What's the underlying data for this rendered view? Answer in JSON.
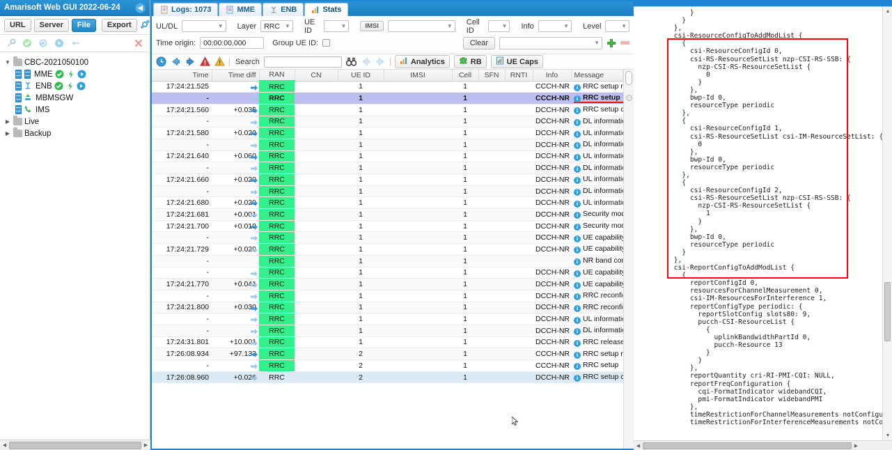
{
  "sidebar": {
    "title": "Amarisoft Web GUI 2022-06-24",
    "collapse_icon": "chevron-left-icon",
    "buttons": {
      "url": "URL",
      "server": "Server",
      "file": "File",
      "export": "Export",
      "settings_icon": "settings-icon"
    },
    "action_icons": [
      "wrench-icon",
      "check-circle-icon",
      "refresh-icon",
      "play-circle-icon",
      "plug-icon",
      "close-icon"
    ],
    "tree": [
      {
        "label": "CBC-2021050100",
        "type": "folder",
        "expanded": true,
        "depth": 0
      },
      {
        "label": "MME",
        "type": "service",
        "depth": 1,
        "badges": [
          "ok",
          "bolt",
          "play"
        ]
      },
      {
        "label": "ENB",
        "type": "service",
        "depth": 1,
        "badges": [
          "ok",
          "bolt",
          "play"
        ]
      },
      {
        "label": "MBMSGW",
        "type": "service",
        "depth": 1,
        "badges": []
      },
      {
        "label": "IMS",
        "type": "service",
        "depth": 1,
        "badges": []
      },
      {
        "label": "Live",
        "type": "folder",
        "expanded": false,
        "depth": 0
      },
      {
        "label": "Backup",
        "type": "folder",
        "expanded": false,
        "depth": 0
      }
    ]
  },
  "tabs": [
    {
      "label": "Logs: 1073",
      "icon": "document-icon",
      "active": false
    },
    {
      "label": "MME",
      "icon": "list-icon",
      "active": false
    },
    {
      "label": "ENB",
      "icon": "tower-icon",
      "active": false
    },
    {
      "label": "Stats",
      "icon": "chart-icon",
      "active": true
    }
  ],
  "filters": {
    "uldl": {
      "label": "UL/DL",
      "value": ""
    },
    "layer": {
      "label": "Layer",
      "value": "RRC"
    },
    "ueid": {
      "label": "UE ID",
      "value": ""
    },
    "imsi": {
      "label": "IMSI",
      "value": ""
    },
    "cellid": {
      "label": "Cell ID",
      "value": ""
    },
    "info": {
      "label": "Info",
      "value": ""
    },
    "level": {
      "label": "Level",
      "value": ""
    },
    "time_origin": {
      "label": "Time origin:",
      "value": "00:00:00.000"
    },
    "group_ue_id": {
      "label": "Group UE ID:",
      "checked": false
    },
    "clear": "Clear",
    "preset": "",
    "add_icon": "plus-icon",
    "remove_icon": "minus-icon"
  },
  "toolbar": {
    "icons": [
      "clock-icon",
      "arrow-left-icon",
      "arrow-right-icon",
      "error-icon",
      "warning-icon"
    ],
    "search_label": "Search",
    "search_value": "",
    "search_placeholder": "",
    "binoculars_icon": "binoculars-icon",
    "prev_icon": "arrow-left-icon",
    "next_icon": "arrow-right-icon",
    "analytics": "Analytics",
    "rb": "RB",
    "ue_caps": "UE Caps"
  },
  "table": {
    "columns": [
      "Time",
      "Time diff",
      "RAN",
      "CN",
      "UE ID",
      "IMSI",
      "Cell",
      "SFN",
      "RNTI",
      "Info",
      "Message"
    ],
    "rows": [
      {
        "time": "17:24:21.525",
        "diff": "",
        "dir": "dl",
        "ran": "RRC",
        "cn": "",
        "ueid": "1",
        "imsi": "",
        "cell": "1",
        "sfn": "",
        "rnti": "",
        "info": "CCCH-NR",
        "msg": "RRC setup request",
        "state": "even"
      },
      {
        "time": "-",
        "diff": "",
        "dir": "ul",
        "ran": "RRC",
        "cn": "",
        "ueid": "1",
        "imsi": "",
        "cell": "1",
        "sfn": "",
        "rnti": "",
        "info": "CCCH-NR",
        "msg": "RRC setup",
        "state": "sel"
      },
      {
        "time": "17:24:21.560",
        "diff": "+0.035",
        "dir": "dl",
        "ran": "RRC",
        "cn": "",
        "ueid": "1",
        "imsi": "",
        "cell": "1",
        "sfn": "",
        "rnti": "",
        "info": "DCCH-NR",
        "msg": "RRC setup complete",
        "state": "even"
      },
      {
        "time": "-",
        "diff": "",
        "dir": "ul",
        "ran": "RRC",
        "cn": "",
        "ueid": "1",
        "imsi": "",
        "cell": "1",
        "sfn": "",
        "rnti": "",
        "info": "DCCH-NR",
        "msg": "DL information transfer",
        "state": "odd"
      },
      {
        "time": "17:24:21.580",
        "diff": "+0.020",
        "dir": "dl",
        "ran": "RRC",
        "cn": "",
        "ueid": "1",
        "imsi": "",
        "cell": "1",
        "sfn": "",
        "rnti": "",
        "info": "DCCH-NR",
        "msg": "UL information transfer",
        "state": "even"
      },
      {
        "time": "-",
        "diff": "",
        "dir": "ul",
        "ran": "RRC",
        "cn": "",
        "ueid": "1",
        "imsi": "",
        "cell": "1",
        "sfn": "",
        "rnti": "",
        "info": "DCCH-NR",
        "msg": "DL information transfer",
        "state": "odd"
      },
      {
        "time": "17:24:21.640",
        "diff": "+0.060",
        "dir": "dl",
        "ran": "RRC",
        "cn": "",
        "ueid": "1",
        "imsi": "",
        "cell": "1",
        "sfn": "",
        "rnti": "",
        "info": "DCCH-NR",
        "msg": "UL information transfer",
        "state": "even"
      },
      {
        "time": "-",
        "diff": "",
        "dir": "ul",
        "ran": "RRC",
        "cn": "",
        "ueid": "1",
        "imsi": "",
        "cell": "1",
        "sfn": "",
        "rnti": "",
        "info": "DCCH-NR",
        "msg": "DL information transfer",
        "state": "odd"
      },
      {
        "time": "17:24:21.660",
        "diff": "+0.020",
        "dir": "dl",
        "ran": "RRC",
        "cn": "",
        "ueid": "1",
        "imsi": "",
        "cell": "1",
        "sfn": "",
        "rnti": "",
        "info": "DCCH-NR",
        "msg": "UL information transfer",
        "state": "even"
      },
      {
        "time": "-",
        "diff": "",
        "dir": "ul",
        "ran": "RRC",
        "cn": "",
        "ueid": "1",
        "imsi": "",
        "cell": "1",
        "sfn": "",
        "rnti": "",
        "info": "DCCH-NR",
        "msg": "DL information transfer",
        "state": "odd"
      },
      {
        "time": "17:24:21.680",
        "diff": "+0.020",
        "dir": "dl",
        "ran": "RRC",
        "cn": "",
        "ueid": "1",
        "imsi": "",
        "cell": "1",
        "sfn": "",
        "rnti": "",
        "info": "DCCH-NR",
        "msg": "UL information transfer",
        "state": "even"
      },
      {
        "time": "17:24:21.681",
        "diff": "+0.001",
        "dir": "ul",
        "ran": "RRC",
        "cn": "",
        "ueid": "1",
        "imsi": "",
        "cell": "1",
        "sfn": "",
        "rnti": "",
        "info": "DCCH-NR",
        "msg": "Security mode command",
        "state": "odd"
      },
      {
        "time": "17:24:21.700",
        "diff": "+0.019",
        "dir": "dl",
        "ran": "RRC",
        "cn": "",
        "ueid": "1",
        "imsi": "",
        "cell": "1",
        "sfn": "",
        "rnti": "",
        "info": "DCCH-NR",
        "msg": "Security mode complete",
        "state": "even"
      },
      {
        "time": "-",
        "diff": "",
        "dir": "ul",
        "ran": "RRC",
        "cn": "",
        "ueid": "1",
        "imsi": "",
        "cell": "1",
        "sfn": "",
        "rnti": "",
        "info": "DCCH-NR",
        "msg": "UE capability enquiry",
        "state": "odd"
      },
      {
        "time": "17:24:21.729",
        "diff": "+0.029",
        "dir": "ul",
        "ran": "RRC",
        "cn": "",
        "ueid": "1",
        "imsi": "",
        "cell": "1",
        "sfn": "",
        "rnti": "",
        "info": "DCCH-NR",
        "msg": "UE capability information",
        "state": "even"
      },
      {
        "time": "-",
        "diff": "",
        "dir": "",
        "ran": "RRC",
        "cn": "",
        "ueid": "1",
        "imsi": "",
        "cell": "1",
        "sfn": "",
        "rnti": "",
        "info": "",
        "msg": "NR band combinations",
        "state": "odd"
      },
      {
        "time": "-",
        "diff": "",
        "dir": "ul",
        "ran": "RRC",
        "cn": "",
        "ueid": "1",
        "imsi": "",
        "cell": "1",
        "sfn": "",
        "rnti": "",
        "info": "DCCH-NR",
        "msg": "UE capability enquiry",
        "state": "even"
      },
      {
        "time": "17:24:21.770",
        "diff": "+0.041",
        "dir": "ul",
        "ran": "RRC",
        "cn": "",
        "ueid": "1",
        "imsi": "",
        "cell": "1",
        "sfn": "",
        "rnti": "",
        "info": "DCCH-NR",
        "msg": "UE capability information",
        "state": "odd"
      },
      {
        "time": "-",
        "diff": "",
        "dir": "ul",
        "ran": "RRC",
        "cn": "",
        "ueid": "1",
        "imsi": "",
        "cell": "1",
        "sfn": "",
        "rnti": "",
        "info": "DCCH-NR",
        "msg": "RRC reconfiguration",
        "state": "even"
      },
      {
        "time": "17:24:21.800",
        "diff": "+0.030",
        "dir": "dl",
        "ran": "RRC",
        "cn": "",
        "ueid": "1",
        "imsi": "",
        "cell": "1",
        "sfn": "",
        "rnti": "",
        "info": "DCCH-NR",
        "msg": "RRC reconfiguration complete",
        "state": "odd"
      },
      {
        "time": "-",
        "diff": "",
        "dir": "ul",
        "ran": "RRC",
        "cn": "",
        "ueid": "1",
        "imsi": "",
        "cell": "1",
        "sfn": "",
        "rnti": "",
        "info": "DCCH-NR",
        "msg": "UL information transfer",
        "state": "even"
      },
      {
        "time": "-",
        "diff": "",
        "dir": "ul",
        "ran": "RRC",
        "cn": "",
        "ueid": "1",
        "imsi": "",
        "cell": "1",
        "sfn": "",
        "rnti": "",
        "info": "DCCH-NR",
        "msg": "DL information transfer",
        "state": "odd"
      },
      {
        "time": "17:24:31.801",
        "diff": "+10.001",
        "dir": "ul",
        "ran": "RRC",
        "cn": "",
        "ueid": "1",
        "imsi": "",
        "cell": "1",
        "sfn": "",
        "rnti": "",
        "info": "DCCH-NR",
        "msg": "RRC release",
        "state": "even"
      },
      {
        "time": "17:26:08.934",
        "diff": "+97.133",
        "dir": "dl",
        "ran": "RRC",
        "cn": "",
        "ueid": "2",
        "imsi": "",
        "cell": "1",
        "sfn": "",
        "rnti": "",
        "info": "CCCH-NR",
        "msg": "RRC setup request",
        "state": "odd"
      },
      {
        "time": "-",
        "diff": "",
        "dir": "ul",
        "ran": "RRC",
        "cn": "",
        "ueid": "2",
        "imsi": "",
        "cell": "1",
        "sfn": "",
        "rnti": "",
        "info": "CCCH-NR",
        "msg": "RRC setup",
        "state": "even"
      },
      {
        "time": "17:26:08.960",
        "diff": "+0.026",
        "dir": "ul",
        "ran": "RRC",
        "cn": "",
        "ueid": "2",
        "imsi": "",
        "cell": "1",
        "sfn": "",
        "rnti": "",
        "info": "DCCH-NR",
        "msg": "RRC setup complete",
        "state": "hl"
      }
    ]
  },
  "detail": {
    "code": "              }\n            }\n          },\n          csi-ResourceConfigToAddModList {\n            {\n              csi-ResourceConfigId 0,\n              csi-RS-ResourceSetList nzp-CSI-RS-SSB: {\n                nzp-CSI-RS-ResourceSetList {\n                  0\n                }\n              },\n              bwp-Id 0,\n              resourceType periodic\n            },\n            {\n              csi-ResourceConfigId 1,\n              csi-RS-ResourceSetList csi-IM-ResourceSetList: {\n                0\n              },\n              bwp-Id 0,\n              resourceType periodic\n            },\n            {\n              csi-ResourceConfigId 2,\n              csi-RS-ResourceSetList nzp-CSI-RS-SSB: {\n                nzp-CSI-RS-ResourceSetList {\n                  1\n                }\n              },\n              bwp-Id 0,\n              resourceType periodic\n            }\n          },\n          csi-ReportConfigToAddModList {\n            {\n              reportConfigId 0,\n              resourcesForChannelMeasurement 0,\n              csi-IM-ResourcesForInterference 1,\n              reportConfigType periodic: {\n                reportSlotConfig slots80: 9,\n                pucch-CSI-ResourceList {\n                  {\n                    uplinkBandwidthPartId 0,\n                    pucch-Resource 13\n                  }\n                }\n              },\n              reportQuantity cri-RI-PMI-CQI: NULL,\n              reportFreqConfiguration {\n                cqi-FormatIndicator widebandCQI,\n                pmi-FormatIndicator widebandPMI\n              },\n              timeRestrictionForChannelMeasurements notConfigured,\n              timeRestrictionForInterferenceMeasurements notConfigured",
    "highlight_color": "#ff0000"
  }
}
